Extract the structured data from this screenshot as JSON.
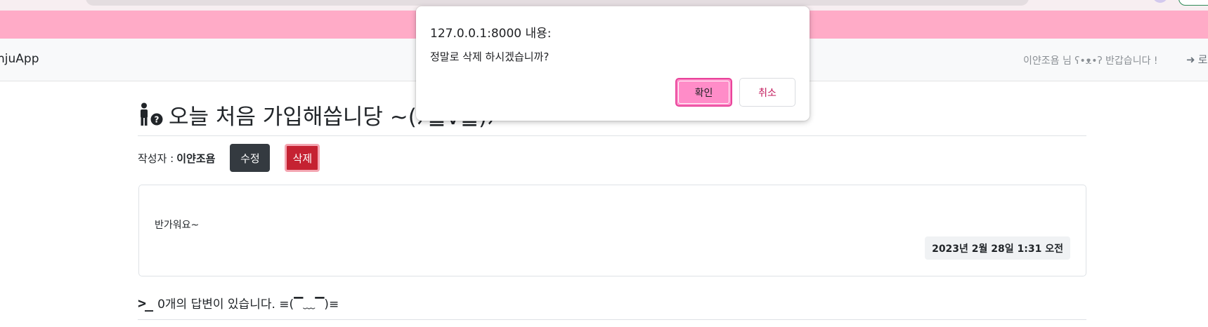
{
  "navbar": {
    "brand": "njuApp",
    "greeting": "이얀조욤 님 ʕ•ᴥ•ʔ 반갑습니다 !",
    "login_label": "로",
    "login_icon": "sign-in-icon"
  },
  "post": {
    "title": "오늘 처음 가입해씁니당 ~(ﾉ≧∇≦)ﾉ",
    "author_label": "작성자 :",
    "author_name": "이얀조욤",
    "edit_label": "수정",
    "delete_label": "삭제",
    "content": "반가워요~",
    "date": "2023년 2월 28일 1:31 오전"
  },
  "answers": {
    "icon": ">_",
    "text": "0개의 답변이 있습니다. ≡(▔﹏▔)≡"
  },
  "dialog": {
    "title": "127.0.0.1:8000 내용:",
    "message": "정말로 삭제 하시겠습니까?",
    "ok_label": "확인",
    "cancel_label": "취소"
  },
  "colors": {
    "accent_pink": "#ffabc7",
    "delete_red": "#c52232",
    "dark_button": "#343a40",
    "dialog_ok": "#ff8cc8"
  }
}
